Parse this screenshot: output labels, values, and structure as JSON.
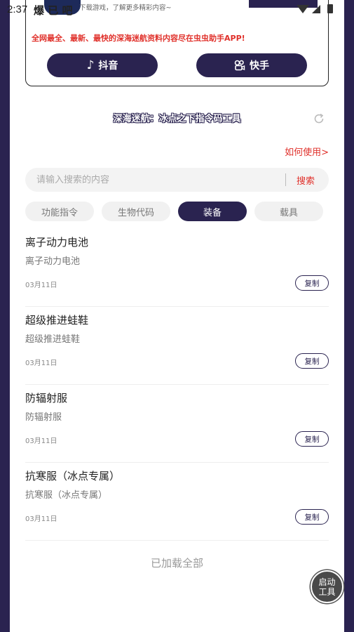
{
  "status": {
    "time": "2:37",
    "app_name": "爆 已 吧"
  },
  "banner": {
    "subtext": "下载游戏，了解更多精彩内容~",
    "promo": "全网最全、最新、最快的深海迷航资料内容尽在虫虫助手APP!",
    "douyin_label": "抖音",
    "kuaishou_label": "快手"
  },
  "tool": {
    "title": "深海迷航：冰点之下指令码工具",
    "howto": "如何使用>"
  },
  "search": {
    "placeholder": "请输入搜索的内容",
    "button": "搜索"
  },
  "tabs": [
    {
      "label": "功能指令",
      "active": false
    },
    {
      "label": "生物代码",
      "active": false
    },
    {
      "label": "装备",
      "active": true
    },
    {
      "label": "载具",
      "active": false
    }
  ],
  "items": [
    {
      "title": "离子动力电池",
      "code": "离子动力电池",
      "date": "03月11日",
      "copy": "复制"
    },
    {
      "title": "超级推进蛙鞋",
      "code": " 超级推进蛙鞋",
      "date": "03月11日",
      "copy": "复制"
    },
    {
      "title": "防辐射服",
      "code": "防辐射服",
      "date": "03月11日",
      "copy": "复制"
    },
    {
      "title": "抗寒服（冰点专属）",
      "code": "抗寒服（冰点专属）",
      "date": "03月11日",
      "copy": "复制"
    }
  ],
  "footer": {
    "loaded_all": "已加载全部"
  },
  "launch": {
    "line1": "启动",
    "line2": "工具"
  },
  "colors": {
    "primary": "#2a2350",
    "accent": "#e0302a"
  }
}
